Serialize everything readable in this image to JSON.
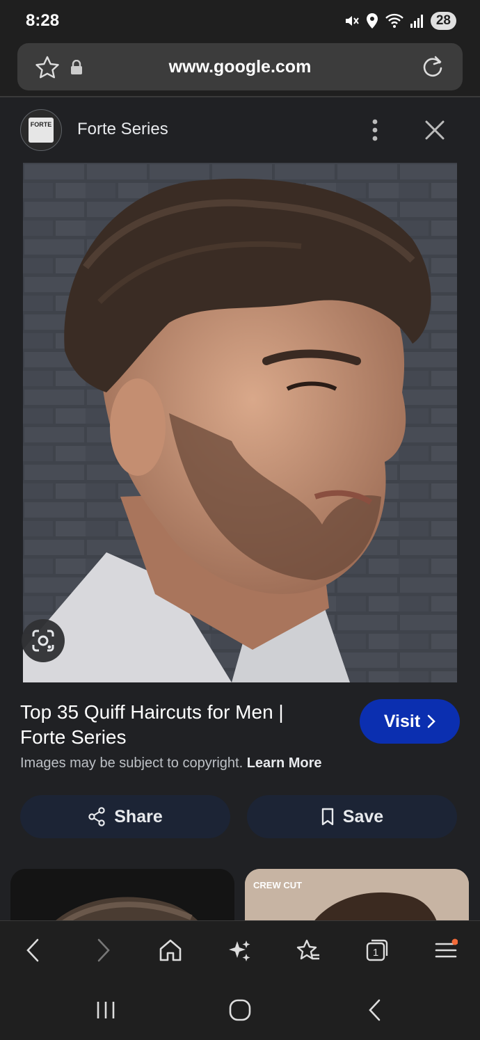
{
  "status_bar": {
    "time": "8:28",
    "battery": "28",
    "icons": [
      "mute-icon",
      "location-icon",
      "wifi-icon",
      "signal-icon"
    ]
  },
  "browser": {
    "url": "www.google.com",
    "icons": [
      "bookmark-star-icon",
      "lock-icon",
      "reload-icon"
    ]
  },
  "result": {
    "site_name": "Forte Series",
    "logo_text": "FORTE",
    "title": "Top 35 Quiff Haircuts for Men | Forte Series",
    "visit_label": "Visit",
    "copyright_text": "Images may be subject to copyright.",
    "learn_more": "Learn More",
    "share_label": "Share",
    "save_label": "Save"
  },
  "related": {
    "items": [
      {
        "label": ""
      },
      {
        "label": "CREW CUT"
      }
    ]
  },
  "toolbar": {
    "items": [
      "back-icon",
      "forward-icon",
      "home-icon",
      "ai-sparkle-icon",
      "bookmarks-icon",
      "tabs-icon",
      "menu-icon"
    ],
    "tabs_count": "1",
    "menu_badge_color": "#f26b3a"
  },
  "colors": {
    "background": "#202124",
    "visit_button": "#0b2fb0",
    "action_button": "#1c2435"
  }
}
